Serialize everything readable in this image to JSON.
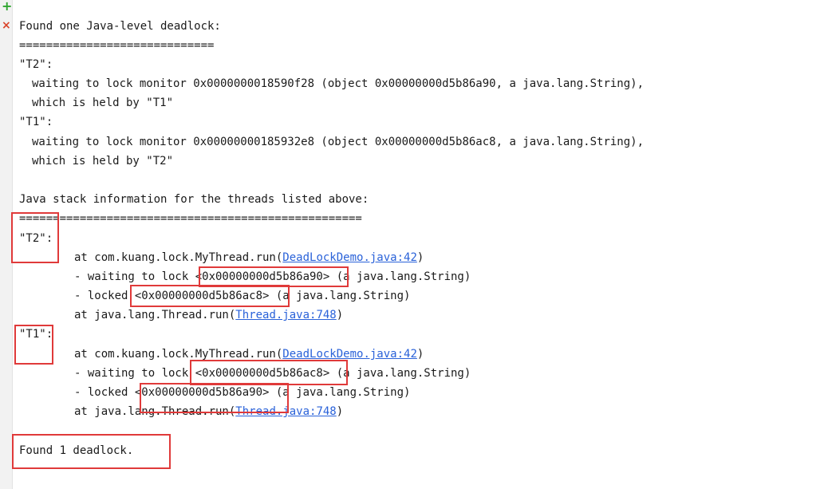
{
  "gutter": {
    "rerun_icon": "+",
    "stop_icon": "×"
  },
  "console": {
    "header": "Found one Java-level deadlock:",
    "sep1": "=============================",
    "t2_name": "\"T2\":",
    "t2_wait": "waiting to lock monitor 0x0000000018590f28 (object 0x00000000d5b86a90, a java.lang.String),",
    "t2_held": "which is held by \"T1\"",
    "t1_name": "\"T1\":",
    "t1_wait": "waiting to lock monitor 0x00000000185932e8 (object 0x00000000d5b86ac8, a java.lang.String),",
    "t1_held": "which is held by \"T2\"",
    "stack_header": "Java stack information for the threads listed above:",
    "sep2": "===================================================",
    "s2_name": "\"T2\":",
    "s2_at_prefix": "at com.kuang.lock.MyThread.run(",
    "s2_at_link": "DeadLockDemo.java:42",
    "s2_at_suffix": ")",
    "s2_wait": "- waiting to lock <0x00000000d5b86a90> (a java.lang.String)",
    "s2_locked": "- locked <0x00000000d5b86ac8> (a java.lang.String)",
    "s2_run_prefix": "at java.lang.Thread.run(",
    "s2_run_link": "Thread.java:748",
    "s2_run_suffix": ")",
    "s1_name": "\"T1\":",
    "s1_at_prefix": "at com.kuang.lock.MyThread.run(",
    "s1_at_link": "DeadLockDemo.java:42",
    "s1_at_suffix": ")",
    "s1_wait": "- waiting to lock <0x00000000d5b86ac8> (a java.lang.String)",
    "s1_locked": "- locked <0x00000000d5b86a90> (a java.lang.String)",
    "s1_run_prefix": "at java.lang.Thread.run(",
    "s1_run_link": "Thread.java:748",
    "s1_run_suffix": ")",
    "footer": "Found 1 deadlock."
  },
  "colors": {
    "highlight": "#e03a3a",
    "link": "#2a62d9",
    "rerun": "#2fa52f",
    "stop": "#d9442b"
  }
}
